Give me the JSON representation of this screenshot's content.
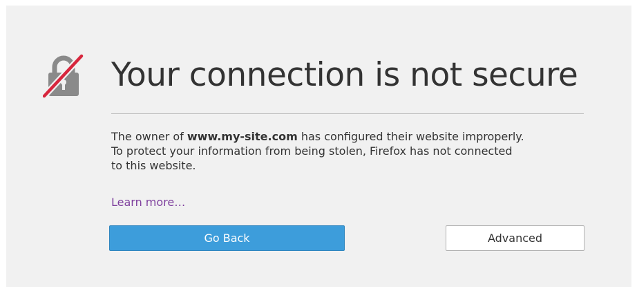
{
  "error_page": {
    "title": "Your connection is not secure",
    "message": {
      "line1_prefix": "The owner of ",
      "site": "www.my-site.com",
      "line1_suffix": " has configured their website improperly.",
      "line2": "To protect your information from being stolen, Firefox has not connected",
      "line3": "to this website."
    },
    "learn_more": "Learn more…",
    "go_back_label": "Go Back",
    "advanced_label": "Advanced",
    "icon": "broken-lock-icon"
  },
  "colors": {
    "panel_background": "#f1f1f1",
    "primary_button": "#3d9ddb",
    "link": "#7e3f9d",
    "lock_gray": "#8a8a8a",
    "strike_red": "#d7263d"
  }
}
